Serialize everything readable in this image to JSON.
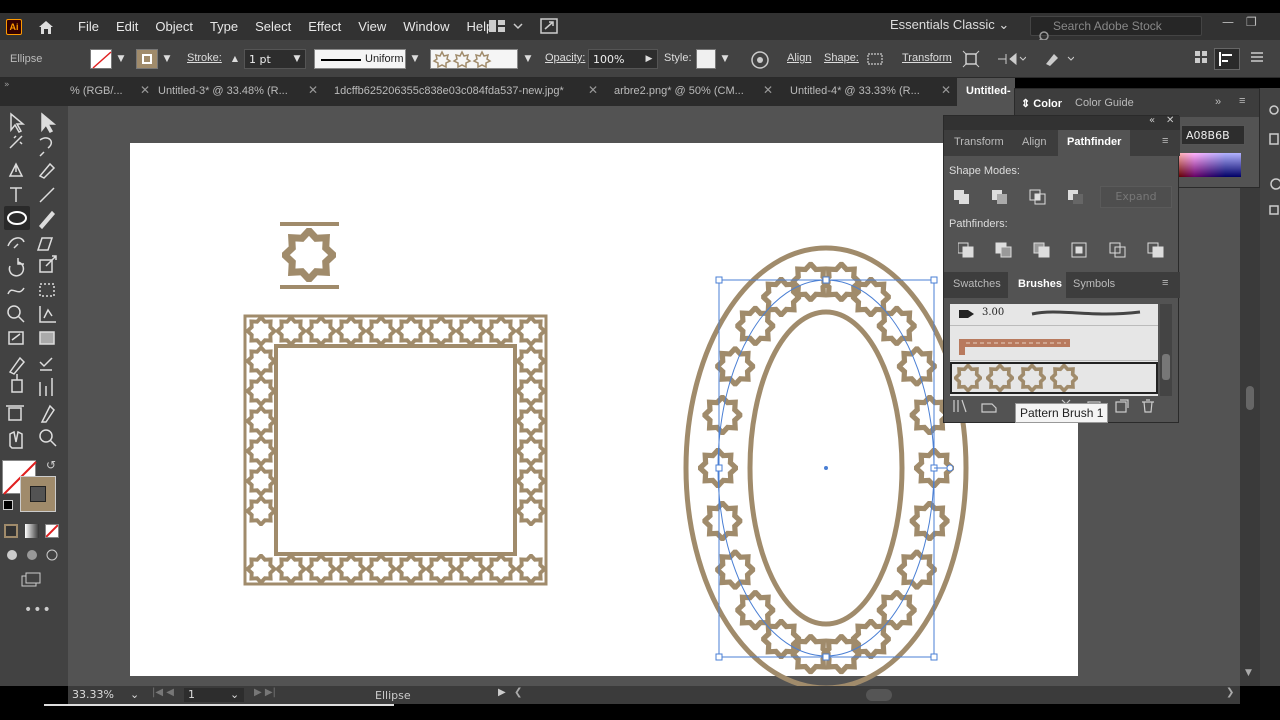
{
  "app": {
    "logo": "Ai"
  },
  "menu": [
    "File",
    "Edit",
    "Object",
    "Type",
    "Select",
    "Effect",
    "View",
    "Window",
    "Help"
  ],
  "workspace": "Essentials Classic",
  "search_placeholder": "Search Adobe Stock",
  "control": {
    "object_type": "Ellipse",
    "stroke_label": "Stroke:",
    "stroke_value": "1 pt",
    "profile": "Uniform",
    "opacity_label": "Opacity:",
    "opacity_value": "100%",
    "style_label": "Style:",
    "align": "Align",
    "shape": "Shape:",
    "transform": "Transform"
  },
  "tabs": [
    {
      "label": "% (RGB/..."
    },
    {
      "label": "Untitled-3* @ 33.48% (R..."
    },
    {
      "label": "1dcffb625206355c838e03c084fda537-new.jpg*"
    },
    {
      "label": "arbre2.png* @ 50% (CM..."
    },
    {
      "label": "Untitled-4* @ 33.33% (R..."
    },
    {
      "label": "Untitled-"
    }
  ],
  "color_panel": {
    "tabs": [
      "Color",
      "Color Guide"
    ],
    "hex": "A08B6B"
  },
  "pathfinder_panel": {
    "tabs": [
      "Transform",
      "Align",
      "Pathfinder"
    ],
    "shape_modes": "Shape Modes:",
    "expand": "Expand",
    "pathfinders": "Pathfinders:"
  },
  "brushes_panel": {
    "tabs": [
      "Swatches",
      "Brushes",
      "Symbols"
    ],
    "size": "3.00",
    "tooltip": "Pattern Brush 1"
  },
  "status": {
    "zoom": "33.33%",
    "page": "1",
    "tool": "Ellipse"
  },
  "colors": {
    "art": "#A08B6B",
    "selection": "#4a7fd4"
  }
}
